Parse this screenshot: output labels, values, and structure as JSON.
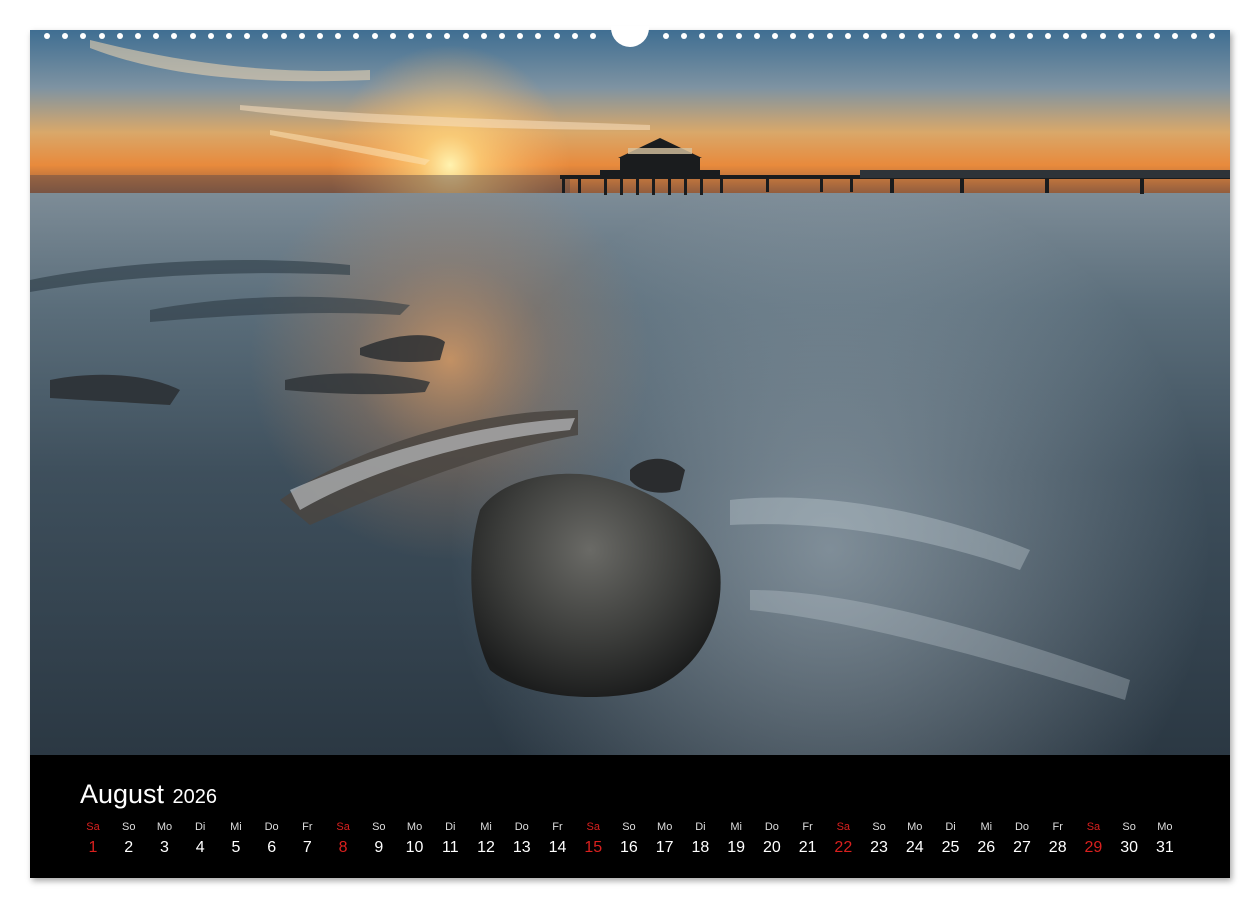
{
  "calendar": {
    "month": "August",
    "year": "2026",
    "days": [
      {
        "wd": "Sa",
        "d": "1",
        "sat": true
      },
      {
        "wd": "So",
        "d": "2"
      },
      {
        "wd": "Mo",
        "d": "3"
      },
      {
        "wd": "Di",
        "d": "4"
      },
      {
        "wd": "Mi",
        "d": "5"
      },
      {
        "wd": "Do",
        "d": "6"
      },
      {
        "wd": "Fr",
        "d": "7"
      },
      {
        "wd": "Sa",
        "d": "8",
        "sat": true
      },
      {
        "wd": "So",
        "d": "9"
      },
      {
        "wd": "Mo",
        "d": "10"
      },
      {
        "wd": "Di",
        "d": "11"
      },
      {
        "wd": "Mi",
        "d": "12"
      },
      {
        "wd": "Do",
        "d": "13"
      },
      {
        "wd": "Fr",
        "d": "14"
      },
      {
        "wd": "Sa",
        "d": "15",
        "sat": true
      },
      {
        "wd": "So",
        "d": "16"
      },
      {
        "wd": "Mo",
        "d": "17"
      },
      {
        "wd": "Di",
        "d": "18"
      },
      {
        "wd": "Mi",
        "d": "19"
      },
      {
        "wd": "Do",
        "d": "20"
      },
      {
        "wd": "Fr",
        "d": "21"
      },
      {
        "wd": "Sa",
        "d": "22",
        "sat": true
      },
      {
        "wd": "So",
        "d": "23"
      },
      {
        "wd": "Mo",
        "d": "24"
      },
      {
        "wd": "Di",
        "d": "25"
      },
      {
        "wd": "Mi",
        "d": "26"
      },
      {
        "wd": "Do",
        "d": "27"
      },
      {
        "wd": "Fr",
        "d": "28"
      },
      {
        "wd": "Sa",
        "d": "29",
        "sat": true
      },
      {
        "wd": "So",
        "d": "30"
      },
      {
        "wd": "Mo",
        "d": "31"
      }
    ]
  },
  "colors": {
    "saturday": "#d9201e",
    "bar": "#000000"
  }
}
